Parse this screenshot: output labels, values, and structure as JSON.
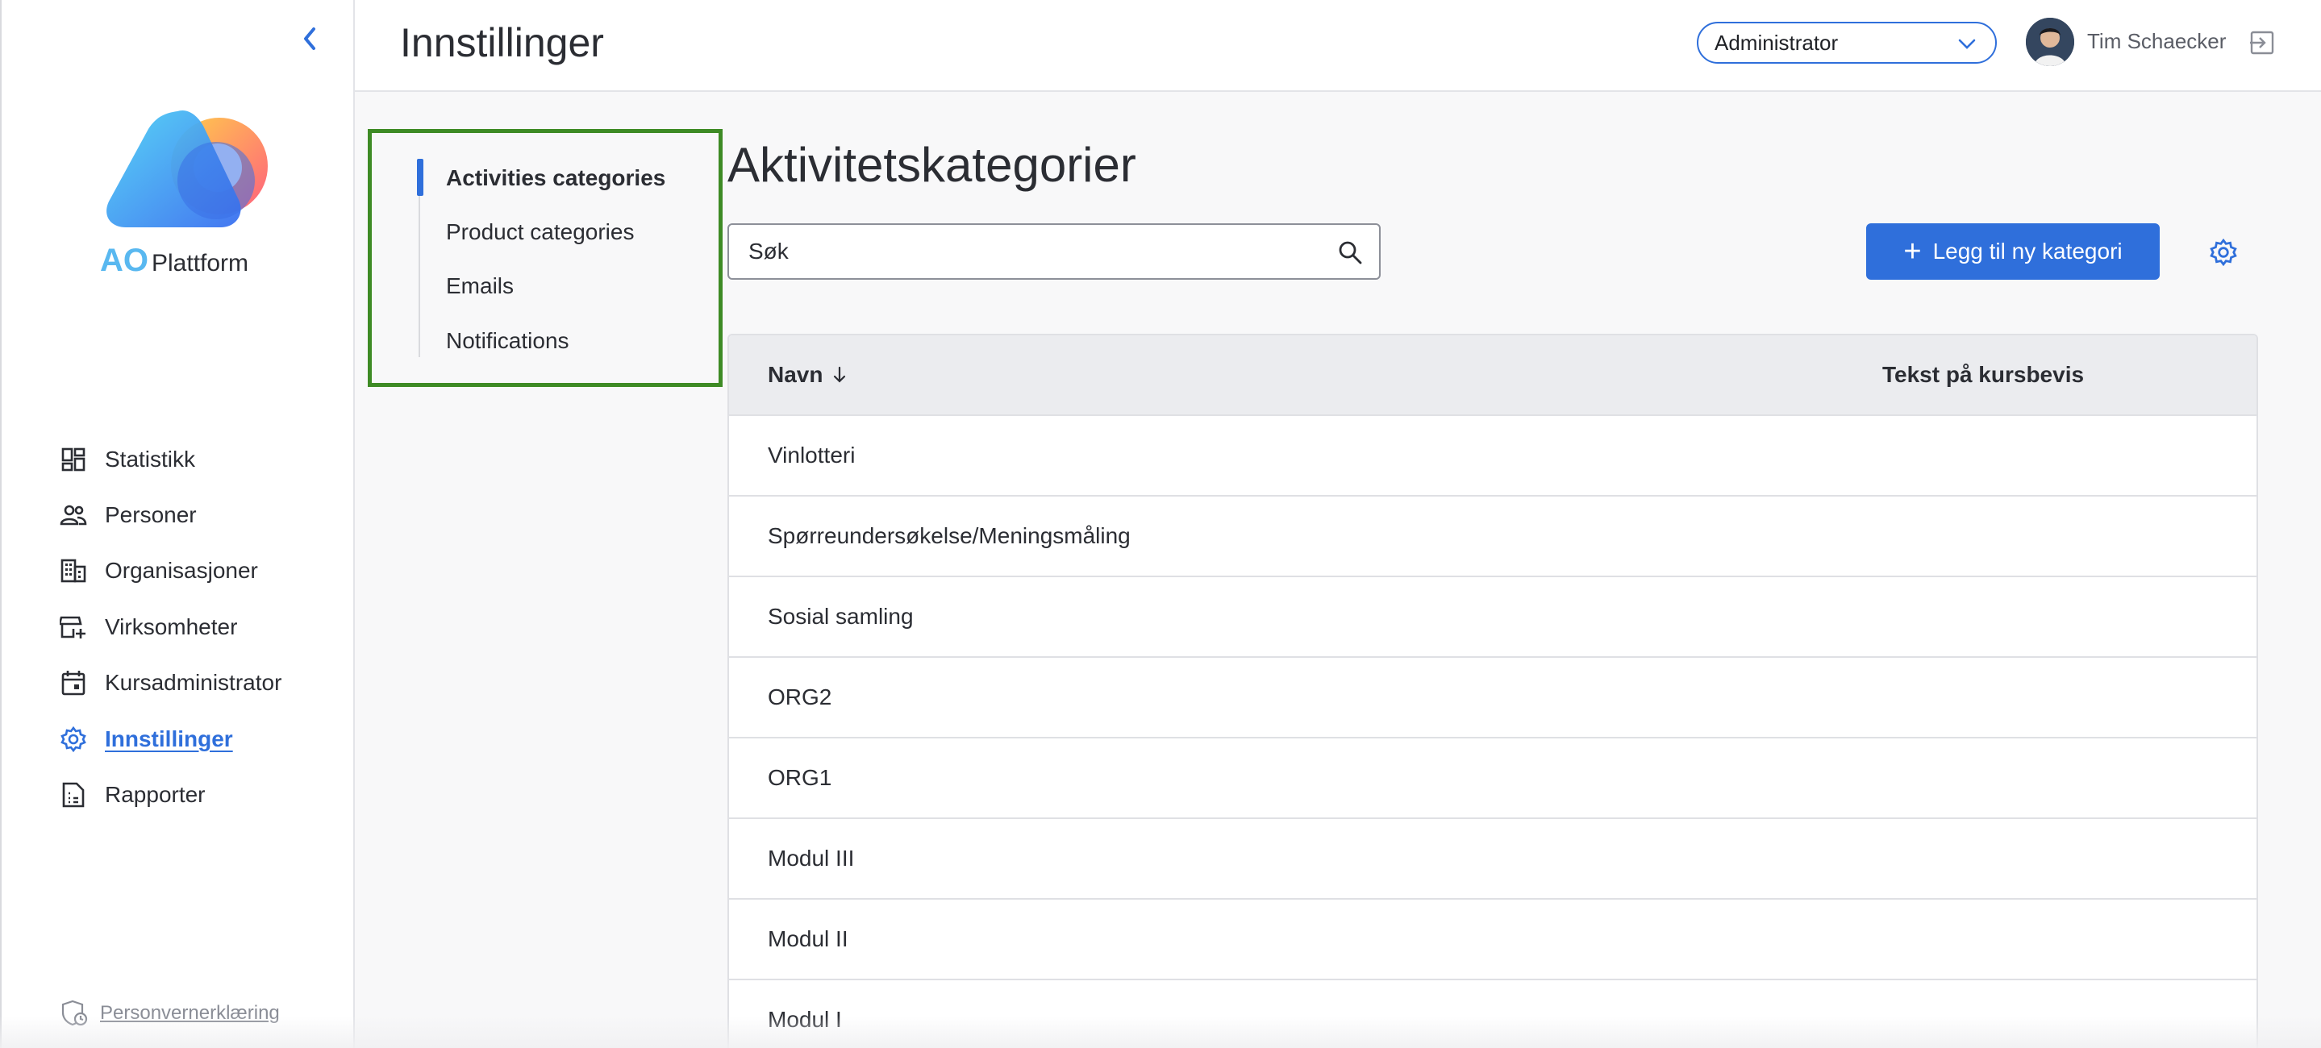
{
  "header": {
    "title": "Innstillinger",
    "role": "Administrator",
    "user_name": "Tim Schaecker"
  },
  "brand": {
    "logo_initials": "AO",
    "logo_name": "Plattform",
    "accent_color": "#2f6fdb"
  },
  "sidebar": {
    "items": [
      {
        "label": "Statistikk",
        "icon": "dashboard-icon"
      },
      {
        "label": "Personer",
        "icon": "people-icon"
      },
      {
        "label": "Organisasjoner",
        "icon": "building-icon"
      },
      {
        "label": "Virksomheter",
        "icon": "store-add-icon"
      },
      {
        "label": "Kursadministrator",
        "icon": "calendar-icon"
      },
      {
        "label": "Innstillinger",
        "icon": "gear-icon",
        "active": true
      },
      {
        "label": "Rapporter",
        "icon": "report-icon"
      }
    ],
    "privacy_label": "Personvernerklæring"
  },
  "subnav": {
    "items": [
      {
        "label": "Activities categories",
        "active": true
      },
      {
        "label": "Product categories"
      },
      {
        "label": "Emails"
      },
      {
        "label": "Notifications"
      }
    ]
  },
  "main": {
    "title": "Aktivitetskategorier",
    "search_placeholder": "Søk",
    "add_button_label": "Legg til ny kategori",
    "table": {
      "columns": [
        "Navn",
        "Tekst på kursbevis"
      ],
      "rows": [
        "Vinlotteri",
        "Spørreundersøkelse/Meningsmåling",
        "Sosial samling",
        "ORG2",
        "ORG1",
        "Modul III",
        "Modul II",
        "Modul I"
      ]
    }
  }
}
